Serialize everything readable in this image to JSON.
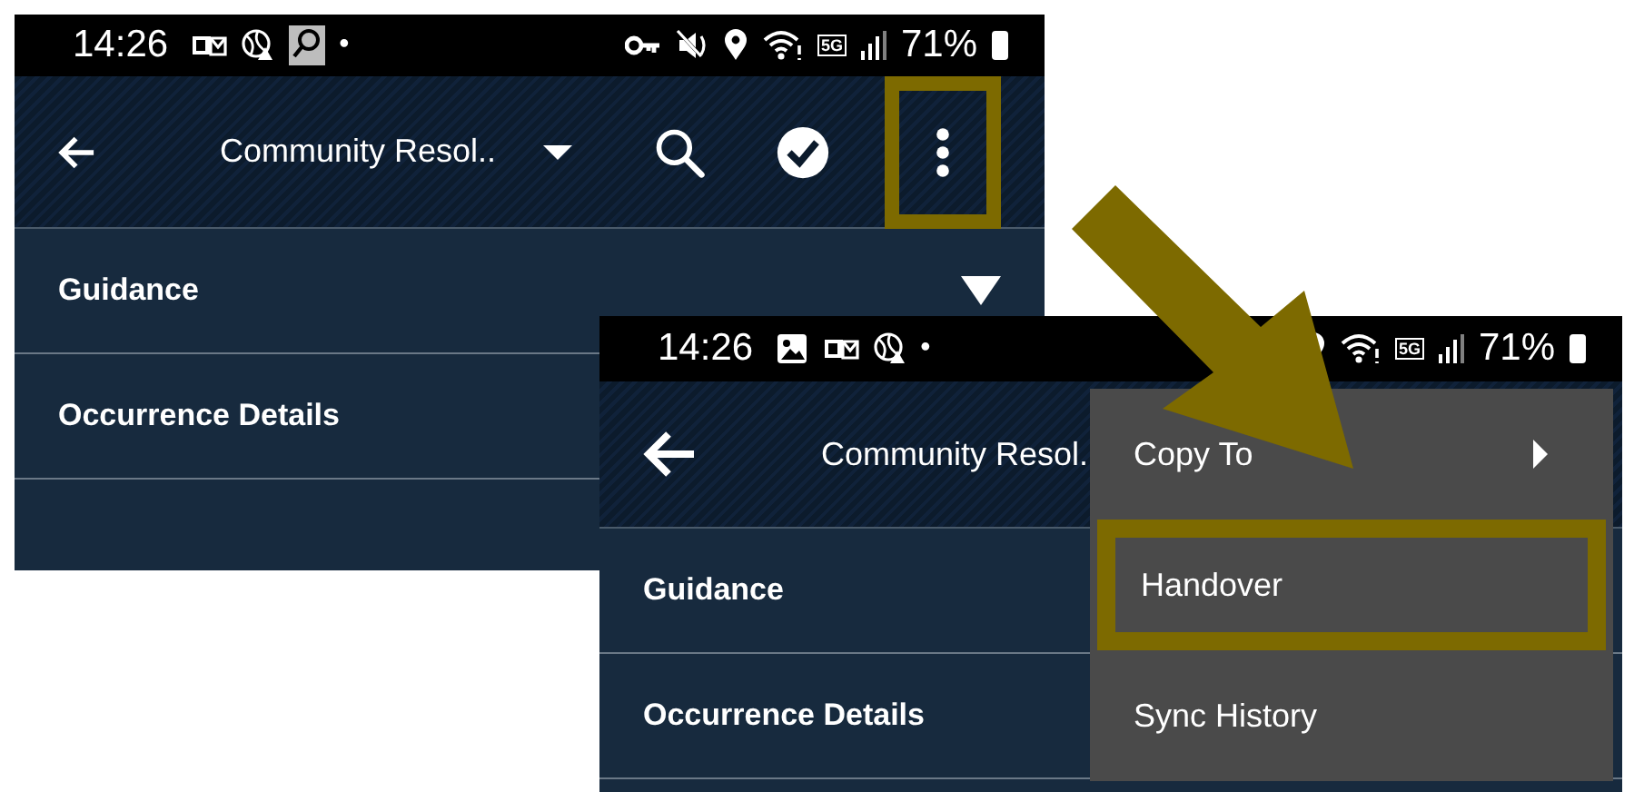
{
  "screens": [
    {
      "status_bar": {
        "time": "14:26",
        "dot": "•",
        "network": "5G",
        "battery": "71%"
      },
      "app_bar": {
        "title": "Community Resol..",
        "actions": [
          {
            "kind": "search",
            "highlighted": false
          },
          {
            "kind": "check",
            "highlighted": false
          },
          {
            "kind": "more",
            "highlighted": true
          }
        ]
      },
      "sections": [
        {
          "label": "Guidance",
          "kind": "dropdown"
        },
        {
          "label": "Occurrence Details",
          "kind": "plain"
        }
      ]
    },
    {
      "status_bar": {
        "time": "14:26",
        "dot": "•",
        "network": "5G",
        "battery": "71%"
      },
      "app_bar": {
        "title": "Community Resol."
      },
      "sections": [
        {
          "label": "Guidance",
          "kind": "plain"
        },
        {
          "label": "Occurrence Details",
          "kind": "plain"
        }
      ],
      "menu": [
        {
          "label": "Copy To",
          "kind": "submenu",
          "highlighted": false
        },
        {
          "label": "Handover",
          "kind": "action",
          "highlighted": true
        },
        {
          "label": "Sync History",
          "kind": "action",
          "highlighted": false
        }
      ]
    }
  ]
}
